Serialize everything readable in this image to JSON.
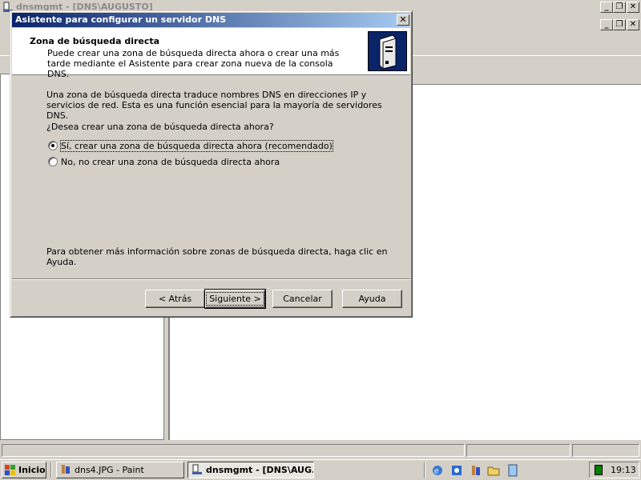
{
  "bg_window": {
    "title": "dnsmgmt - [DNS\\AUGUSTO]"
  },
  "dialog": {
    "title": "Asistente para configurar un servidor DNS",
    "close_glyph": "✕",
    "header": {
      "title": "Zona de búsqueda directa",
      "description": "Puede crear una zona de búsqueda directa ahora o crear una más tarde mediante el Asistente para crear zona nueva de la consola DNS."
    },
    "body": {
      "paragraph": "Una zona de búsqueda directa traduce nombres DNS en direcciones IP y servicios de red. Esta es una función esencial para la mayoría de servidores DNS.",
      "question": "¿Desea crear una zona de búsqueda directa ahora?",
      "options": [
        {
          "label": "Sí, crear una zona de búsqueda directa ahora (recomendado)",
          "selected": true
        },
        {
          "label": "No, no crear una zona de búsqueda directa ahora",
          "selected": false
        }
      ],
      "help_text": "Para obtener más información sobre zonas de búsqueda directa, haga clic en Ayuda."
    },
    "buttons": {
      "back": "< Atrás",
      "next": "Siguiente >",
      "cancel": "Cancelar",
      "help": "Ayuda"
    }
  },
  "taskbar": {
    "start_label": "Inicio",
    "tasks": [
      {
        "label": "dns4.JPG - Paint",
        "icon": "paint-icon",
        "active": false
      },
      {
        "label": "dnsmgmt - [DNS\\AUG...",
        "icon": "dns-console-icon",
        "active": true
      }
    ],
    "quicklaunch_icons": [
      "ie-icon",
      "outlook-icon",
      "paint-icon",
      "folder-icon",
      "notepad-icon"
    ],
    "clock": "19:13"
  },
  "colors": {
    "title_active_start": "#0a246a",
    "title_active_end": "#a6caf0",
    "face": "#d4d0c8"
  }
}
